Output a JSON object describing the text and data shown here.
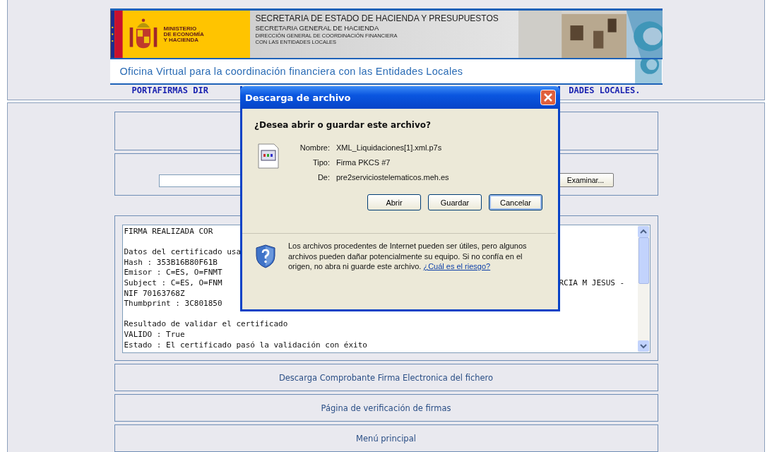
{
  "banner": {
    "ministry": [
      "MINISTERIO",
      "DE ECONOMÍA",
      "Y HACIENDA"
    ],
    "secretariat": "SECRETARIA DE ESTADO DE HACIENDA Y PRESUPUESTOS",
    "subsecretariat": "SECRETARIA GENERAL DE HACIENDA",
    "direction": [
      "DIRECCIÓN GENERAL DE COORDINACIÓN FINANCIERA",
      "CON LAS ENTIDADES LOCALES"
    ],
    "tagline": "Oficina Virtual para la coordinación financiera con las Entidades Locales"
  },
  "page_title": {
    "left": "PORTAFIRMAS DIR",
    "right": "DADES LOCALES."
  },
  "file_upload": {
    "button": "Examinar..."
  },
  "result_lines": [
    {
      "left": "FIRMA REALIZADA COR"
    },
    {
      "left": "Datos del certificado usa",
      "gap_before": true
    },
    {
      "left": "Hash : 353B16B80F61B"
    },
    {
      "left": "Emisor : C=ES, O=FNMT"
    },
    {
      "left": "Subject : C=ES, O=FNM",
      "right": "RCIA M JESUS -"
    },
    {
      "left": "NIF 70163768Z"
    },
    {
      "left": "Thumbprint : 3C801850"
    },
    {
      "left": "Resultado de validar el certificado",
      "gap_before": true
    },
    {
      "left": "VALIDO : True"
    },
    {
      "left": "Estado : El certificado pasó la validación con éxito"
    }
  ],
  "links": [
    "Descarga Comprobante Firma Electronica del fichero",
    "Página de verificación de firmas",
    "Menú principal"
  ],
  "dialog": {
    "title": "Descarga de archivo",
    "question": "¿Desea abrir o guardar este archivo?",
    "fields": [
      {
        "label": "Nombre:",
        "value": "XML_Liquidaciones[1].xml.p7s"
      },
      {
        "label": "Tipo:",
        "value": "Firma PKCS #7"
      },
      {
        "label": "De:",
        "value": "pre2serviciostelematicos.meh.es"
      }
    ],
    "buttons": [
      {
        "label": "Abrir",
        "selected": false
      },
      {
        "label": "Guardar",
        "selected": false
      },
      {
        "label": "Cancelar",
        "selected": true
      }
    ],
    "warning": "Los archivos procedentes de Internet pueden ser útiles, pero algunos archivos pueden dañar potencialmente su equipo. Si no confía en el origen, no abra ni guarde este archivo.",
    "warning_link": "¿Cuál es el riesgo?"
  }
}
